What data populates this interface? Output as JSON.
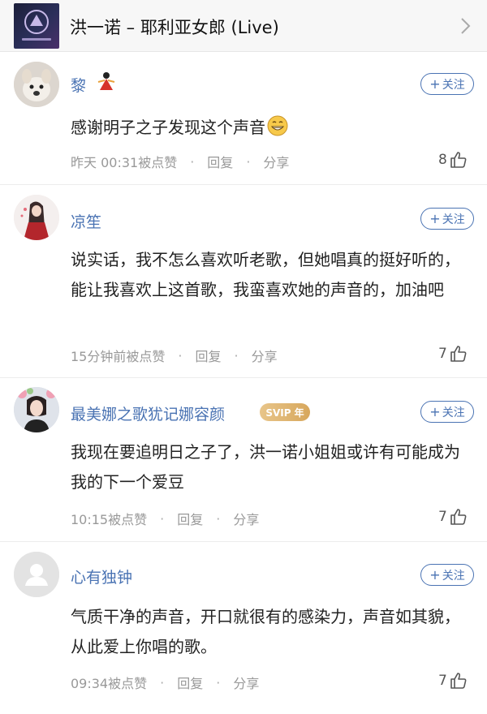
{
  "header": {
    "song_title": "洪一诺 – 耶利亚女郎 (Live)",
    "cover_icon": "album-cover",
    "chevron_icon": "chevron-right-icon"
  },
  "comments": [
    {
      "username": "黎",
      "text": "感谢明子之子发现这个声音",
      "time": "昨天 00:31被点赞",
      "reply_label": "回复",
      "share_label": "分享",
      "likes": "8",
      "follow_label": "关注"
    },
    {
      "username": "凉笙",
      "text": "说实话，我不怎么喜欢听老歌，但她唱真的挺好听的，能让我喜欢上这首歌，我蛮喜欢她的声音的，加油吧",
      "time": "15分钟前被点赞",
      "reply_label": "回复",
      "share_label": "分享",
      "likes": "7",
      "follow_label": "关注"
    },
    {
      "username": "最美娜之歌犹记娜容颜",
      "badge": "SVIP 年",
      "text": "我现在要追明日之子了，洪一诺小姐姐或许有可能成为我的下一个爱豆",
      "time": "10:15被点赞",
      "reply_label": "回复",
      "share_label": "分享",
      "likes": "7",
      "follow_label": "关注"
    },
    {
      "username": "心有独钟",
      "text": "气质干净的声音，开口就很有的感染力，声音如其貌，从此爱上你唱的歌。",
      "time": "09:34被点赞",
      "reply_label": "回复",
      "share_label": "分享",
      "likes": "7",
      "follow_label": "关注"
    }
  ],
  "colors": {
    "link_blue": "#4a73b3",
    "meta_gray": "#999999",
    "svip_gold": "#d7a75c"
  }
}
